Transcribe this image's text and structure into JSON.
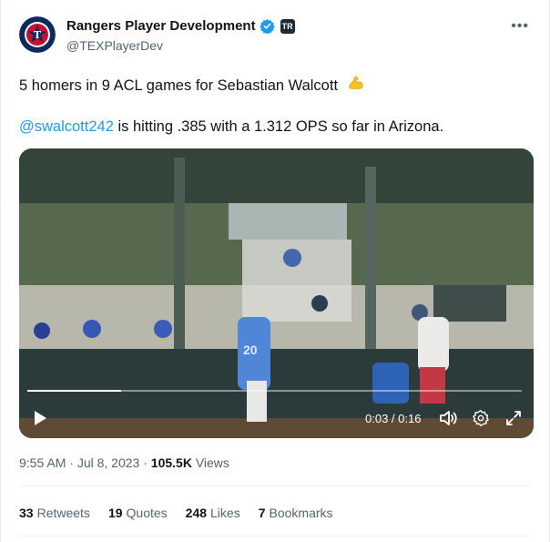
{
  "author": {
    "display_name": "Rangers Player Development",
    "handle": "@TEXPlayerDev",
    "affiliate_badge": "TR"
  },
  "tweet": {
    "line1_text": "5 homers in 9 ACL games for Sebastian Walcott",
    "mention": "@swalcott242",
    "line2_rest": " is hitting .385 with a 1.312 OPS so far in Arizona."
  },
  "video": {
    "time": "0:03 / 0:16",
    "progress": 0.19,
    "jersey_number": "20"
  },
  "meta": {
    "time": "9:55 AM",
    "separator": "·",
    "date": "Jul 8, 2023",
    "views_count": "105.5K",
    "views_label": "Views"
  },
  "stats": [
    {
      "count": "33",
      "label": "Retweets"
    },
    {
      "count": "19",
      "label": "Quotes"
    },
    {
      "count": "248",
      "label": "Likes"
    },
    {
      "count": "7",
      "label": "Bookmarks"
    }
  ],
  "colors": {
    "link": "#1d9bf0",
    "verified": "#1d9bf0",
    "secondary": "#536471"
  },
  "icons": [
    "more-icon",
    "verified-icon",
    "flex-emoji-icon",
    "play-icon",
    "volume-icon",
    "settings-icon",
    "fullscreen-icon"
  ]
}
